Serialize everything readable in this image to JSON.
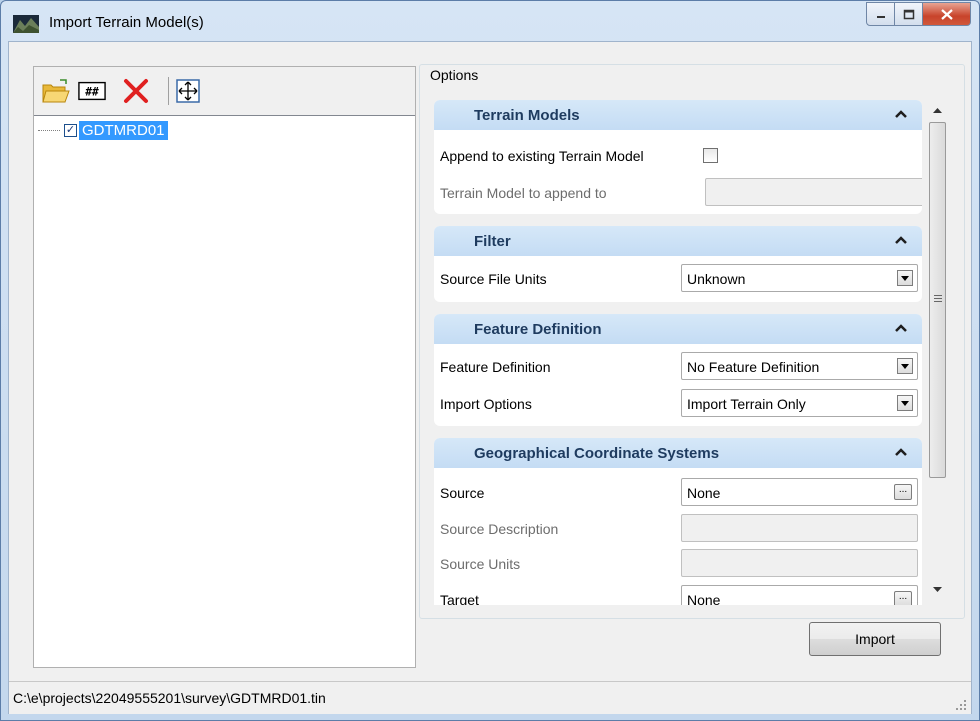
{
  "window": {
    "title": "Import Terrain Model(s)"
  },
  "tree": {
    "items": [
      {
        "label": "GDTMRD01",
        "checked": true
      }
    ]
  },
  "options": {
    "legend": "Options",
    "terrain_models": {
      "title": "Terrain Models",
      "append_label": "Append to existing Terrain Model",
      "append_checked": false,
      "append_to_label": "Terrain Model to append to",
      "append_to_value": ""
    },
    "filter": {
      "title": "Filter",
      "units_label": "Source File Units",
      "units_value": "Unknown"
    },
    "feature_definition": {
      "title": "Feature Definition",
      "def_label": "Feature Definition",
      "def_value": "No Feature Definition",
      "import_label": "Import Options",
      "import_value": "Import Terrain Only"
    },
    "gcs": {
      "title": "Geographical Coordinate Systems",
      "source_label": "Source",
      "source_value": "None",
      "source_desc_label": "Source Description",
      "source_units_label": "Source Units",
      "target_label": "Target",
      "target_value": "None"
    }
  },
  "buttons": {
    "import": "Import",
    "browse": "..."
  },
  "status": {
    "path": "C:\\e\\projects\\22049555201\\survey\\GDTMRD01.tin"
  },
  "colors": {
    "selection": "#3399ff",
    "section_header": "#c4dcf4",
    "delete_x": "#e02020"
  }
}
